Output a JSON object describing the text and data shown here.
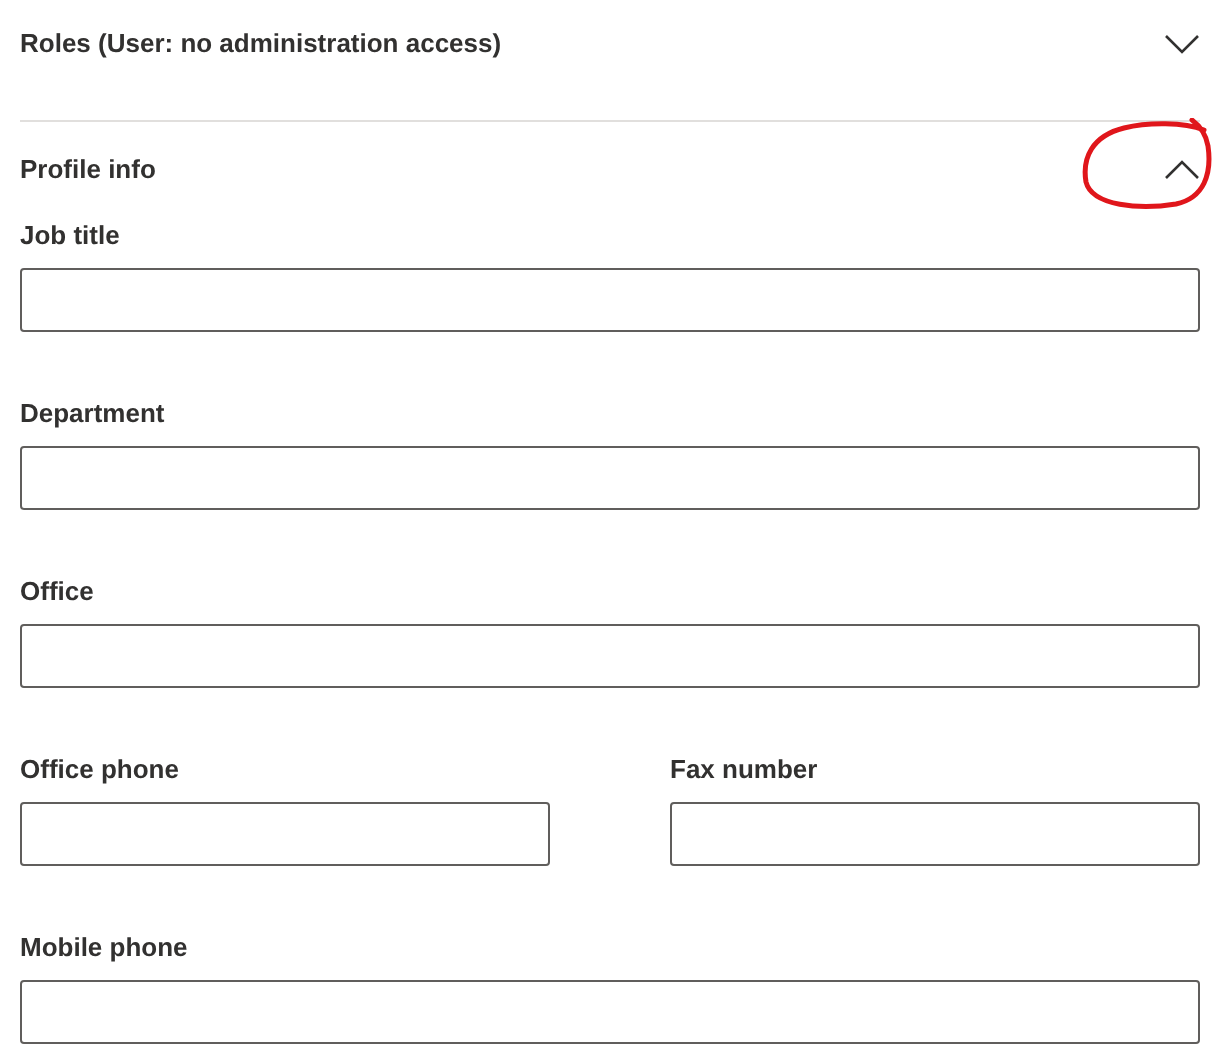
{
  "sections": [
    {
      "title": "Roles (User: no administration access)",
      "expanded": false,
      "circled": false
    },
    {
      "title": "Profile info",
      "expanded": true,
      "circled": true,
      "rows": [
        [
          {
            "label": "Job title"
          }
        ],
        [
          {
            "label": "Department"
          }
        ],
        [
          {
            "label": "Office"
          }
        ],
        [
          {
            "label": "Office phone"
          },
          {
            "label": "Fax number"
          }
        ],
        [
          {
            "label": "Mobile phone"
          }
        ]
      ]
    }
  ]
}
